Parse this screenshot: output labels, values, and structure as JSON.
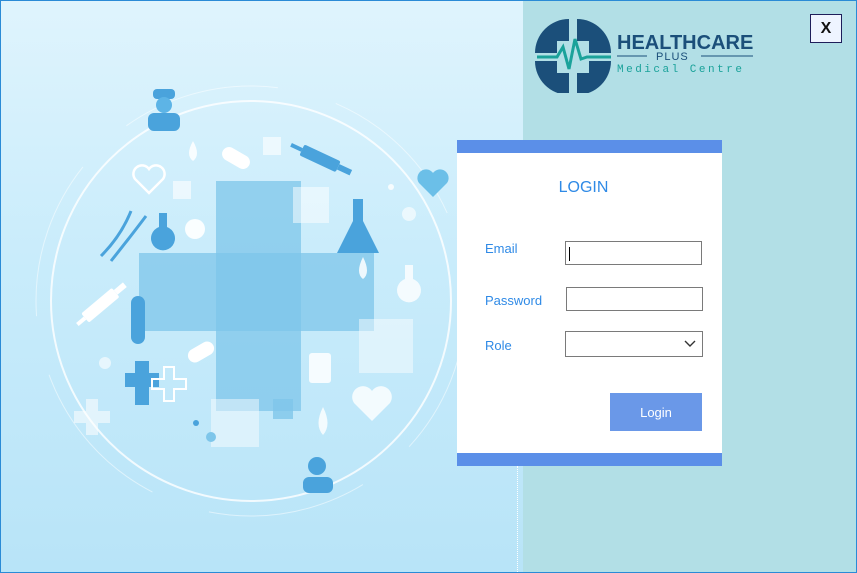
{
  "window": {
    "close_label": "X"
  },
  "logo": {
    "name": "HEALTHCARE",
    "sub": "PLUS",
    "tagline": "Medical Centre"
  },
  "login": {
    "title": "LOGIN",
    "email_label": "Email",
    "email_value": "",
    "password_label": "Password",
    "password_value": "",
    "role_label": "Role",
    "role_value": "",
    "submit_label": "Login"
  },
  "colors": {
    "accent": "#5b8fe8",
    "label": "#2f8ae6",
    "right_panel": "#b2dfe6",
    "logo_navy": "#1b4f7a",
    "logo_teal": "#1aa29a"
  }
}
